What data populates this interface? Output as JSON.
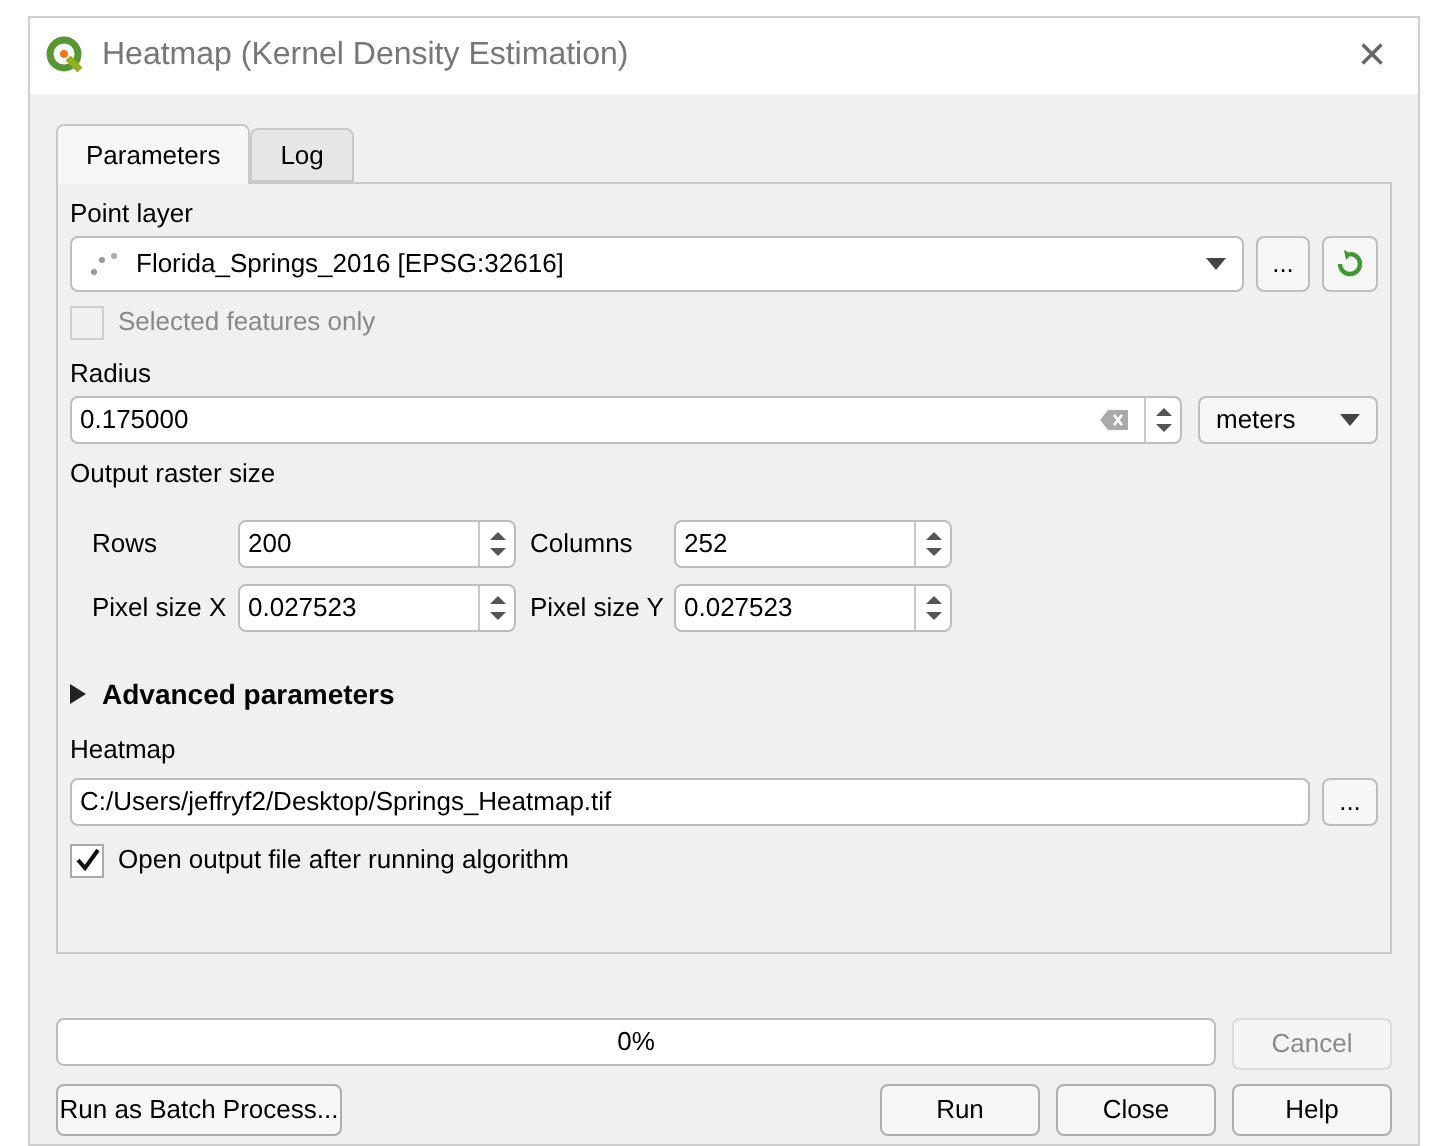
{
  "window": {
    "title": "Heatmap (Kernel Density Estimation)",
    "close": "×"
  },
  "tabs": [
    {
      "label": "Parameters",
      "selected": true
    },
    {
      "label": "Log",
      "selected": false
    }
  ],
  "point_layer": {
    "label": "Point layer",
    "value": "Florida_Springs_2016 [EPSG:32616]",
    "browse": "..."
  },
  "selected_only": {
    "label": "Selected features only",
    "checked": false,
    "disabled": true
  },
  "radius": {
    "label": "Radius",
    "value": "0.175000",
    "unit": "meters"
  },
  "output_raster": {
    "label": "Output raster size",
    "fields": [
      {
        "label": "Rows",
        "value": "200"
      },
      {
        "label": "Columns",
        "value": "252"
      },
      {
        "label": "Pixel size X",
        "value": "0.027523"
      },
      {
        "label": "Pixel size Y",
        "value": "0.027523"
      }
    ]
  },
  "advanced": {
    "label": "Advanced parameters",
    "expanded": false
  },
  "heatmap": {
    "label": "Heatmap",
    "value": "C:/Users/jeffryf2/Desktop/Springs_Heatmap.tif",
    "browse": "..."
  },
  "open_output": {
    "label": "Open output file after running algorithm",
    "checked": true
  },
  "progress": {
    "text": "0%",
    "level": 0
  },
  "buttons": [
    {
      "label": "Cancel",
      "disabled": true
    },
    {
      "label": "Run as Batch Process...",
      "disabled": false
    },
    {
      "label": "Run",
      "disabled": false
    },
    {
      "label": "Close",
      "disabled": false
    },
    {
      "label": "Help",
      "disabled": false
    }
  ]
}
